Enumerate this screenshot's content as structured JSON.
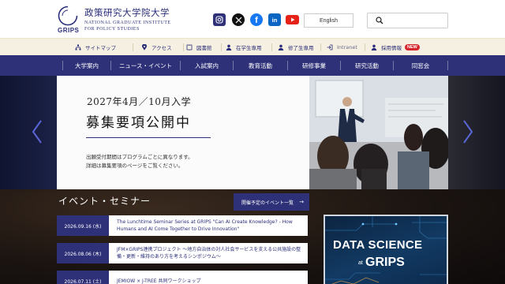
{
  "header": {
    "logo_grips": "GRIPS",
    "logo_jp": "政策研究大学院大学",
    "logo_en_line1": "National Graduate Institute",
    "logo_en_line2": "for Policy Studies",
    "lang_button": "English",
    "search_placeholder": ""
  },
  "social": [
    "instagram-icon",
    "x-icon",
    "facebook-icon",
    "linkedin-icon",
    "youtube-icon"
  ],
  "utility": {
    "sitemap": "サイトマップ",
    "access": "アクセス",
    "library": "図書館",
    "students": "在学生専用",
    "alumni": "修了生専用",
    "intranet": "Intranet",
    "jobs": "採用情報",
    "new_badge": "NEW"
  },
  "nav": {
    "items": [
      "大学案内",
      "ニュース・イベント",
      "入試案内",
      "教育活動",
      "研修事業",
      "研究活動",
      "同窓会"
    ]
  },
  "hero": {
    "title_line1": "2027年4月／10月入学",
    "title_line2": "募集要項公開中",
    "note_line1": "出願受付期間はプログラムごとに異なります。",
    "note_line2": "詳細は募集要項のページをご覧ください。"
  },
  "events": {
    "heading": "イベント・セミナー",
    "all_button": "開催予定のイベント一覧",
    "items": [
      {
        "date": "2026.09.16 (水)",
        "text": "The Lunchtime Seminar Series at GRIPS \"Can AI Create Knowledge? - How Humans and AI Come Together to Drive Innovation\""
      },
      {
        "date": "2026.08.06 (木)",
        "text": "JFM×GRIPS連携プロジェクト 〜地方自治体の対人社会サービスを支える公共施設の整備・更新・維持のあり方を考えるシンポジウム〜"
      },
      {
        "date": "2026.07.11 (土)",
        "text": "JEMIOW × J-TREE 共同ワークショップ"
      }
    ]
  },
  "banner": {
    "line1": "DATA SCIENCE",
    "at": "at",
    "line2": "GRIPS"
  },
  "colors": {
    "brand_navy": "#2e3178",
    "utility_bg": "#f6f0e2",
    "new_badge": "#d7262e"
  }
}
